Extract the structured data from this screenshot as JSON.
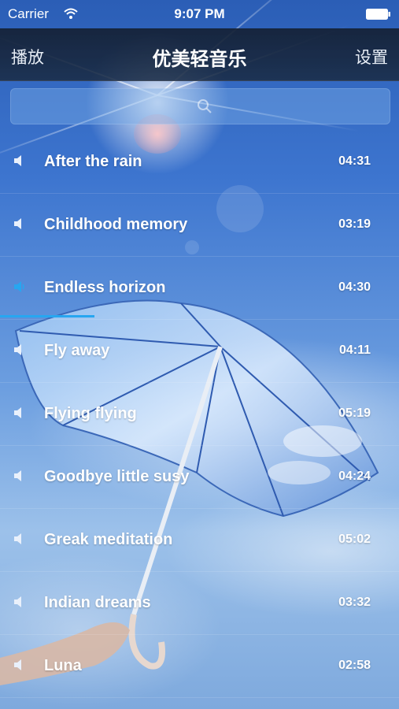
{
  "status": {
    "carrier": "Carrier",
    "time": "9:07 PM"
  },
  "nav": {
    "left": "播放",
    "title": "优美轻音乐",
    "right": "设置"
  },
  "search": {
    "icon": "search-icon"
  },
  "tracks": [
    {
      "title": "After the rain",
      "duration": "04:31",
      "playing": false
    },
    {
      "title": "Childhood memory",
      "duration": "03:19",
      "playing": false
    },
    {
      "title": "Endless horizon",
      "duration": "04:30",
      "playing": true
    },
    {
      "title": "Fly away",
      "duration": "04:11",
      "playing": false
    },
    {
      "title": "Flying flying",
      "duration": "05:19",
      "playing": false
    },
    {
      "title": "Goodbye little susy",
      "duration": "04:24",
      "playing": false
    },
    {
      "title": "Greak meditation",
      "duration": "05:02",
      "playing": false
    },
    {
      "title": "Indian dreams",
      "duration": "03:32",
      "playing": false
    },
    {
      "title": "Luna",
      "duration": "02:58",
      "playing": false
    }
  ],
  "colors": {
    "accent": "#27a6f0",
    "navbar": "#1a2c46"
  }
}
